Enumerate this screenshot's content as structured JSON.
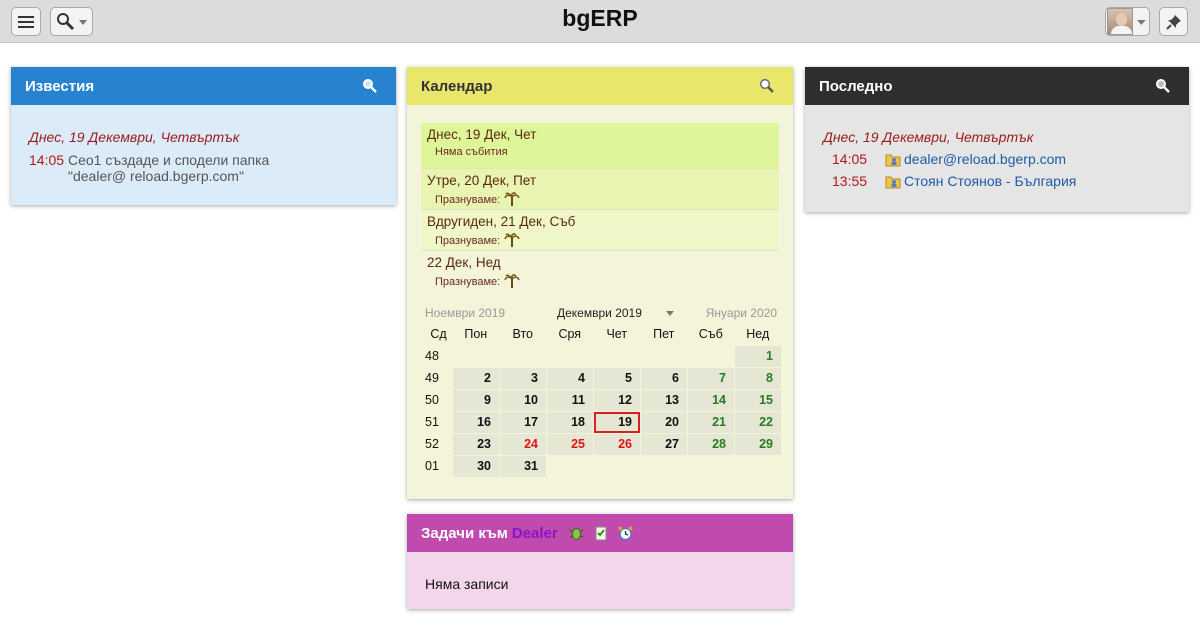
{
  "app": {
    "title": "bgERP"
  },
  "topbar": {
    "menu_icon": "hamburger-icon",
    "search_icon": "search-icon",
    "pin_icon": "pin-icon"
  },
  "news": {
    "title": "Известия",
    "date_heading": "Днес, 19 Декември, Четвъртък",
    "items": [
      {
        "time": "14:05",
        "text": "Ceo1 създаде и сподели папка \"dealer@ reload.bgerp.com\""
      }
    ]
  },
  "calendar": {
    "title": "Календар",
    "agenda": [
      {
        "date": "Днес, 19 Дек, Чет",
        "sub": "Няма събития",
        "has_icon": false
      },
      {
        "date": "Утре, 20 Дек, Пет",
        "sub": "Празнуваме:",
        "has_icon": true
      },
      {
        "date": "Вдругиден, 21 Дек, Съб",
        "sub": "Празнуваме:",
        "has_icon": true
      },
      {
        "date": "22 Дек, Нед",
        "sub": "Празнуваме:",
        "has_icon": true
      }
    ],
    "prev_month": "Ноември 2019",
    "current_month": "Декември 2019",
    "next_month": "Януари 2020",
    "headers": [
      "Сд",
      "Пон",
      "Вто",
      "Сря",
      "Чет",
      "Пет",
      "Съб",
      "Нед"
    ],
    "weeks": [
      {
        "wk": "48",
        "days": [
          "",
          "",
          "",
          "",
          "",
          "",
          "1"
        ]
      },
      {
        "wk": "49",
        "days": [
          "2",
          "3",
          "4",
          "5",
          "6",
          "7",
          "8"
        ]
      },
      {
        "wk": "50",
        "days": [
          "9",
          "10",
          "11",
          "12",
          "13",
          "14",
          "15"
        ]
      },
      {
        "wk": "51",
        "days": [
          "16",
          "17",
          "18",
          "19",
          "20",
          "21",
          "22"
        ]
      },
      {
        "wk": "52",
        "days": [
          "23",
          "24",
          "25",
          "26",
          "27",
          "28",
          "29"
        ]
      },
      {
        "wk": "01",
        "days": [
          "30",
          "31",
          "",
          "",
          "",
          "",
          ""
        ]
      }
    ],
    "today": "19",
    "holidays": [
      "24",
      "25",
      "26"
    ],
    "colors": {
      "weekend": "#2a7a24",
      "holiday": "#e01414",
      "today_border": "#d82020"
    }
  },
  "tasks": {
    "title": "Задачи към",
    "user": "Dealer",
    "empty_text": "Няма записи"
  },
  "recent": {
    "title": "Последно",
    "date_heading": "Днес, 19 Декември, Четвъртък",
    "items": [
      {
        "time": "14:05",
        "label": "dealer@reload.bgerp.com"
      },
      {
        "time": "13:55",
        "label": "Стоян Стоянов - България"
      }
    ]
  }
}
